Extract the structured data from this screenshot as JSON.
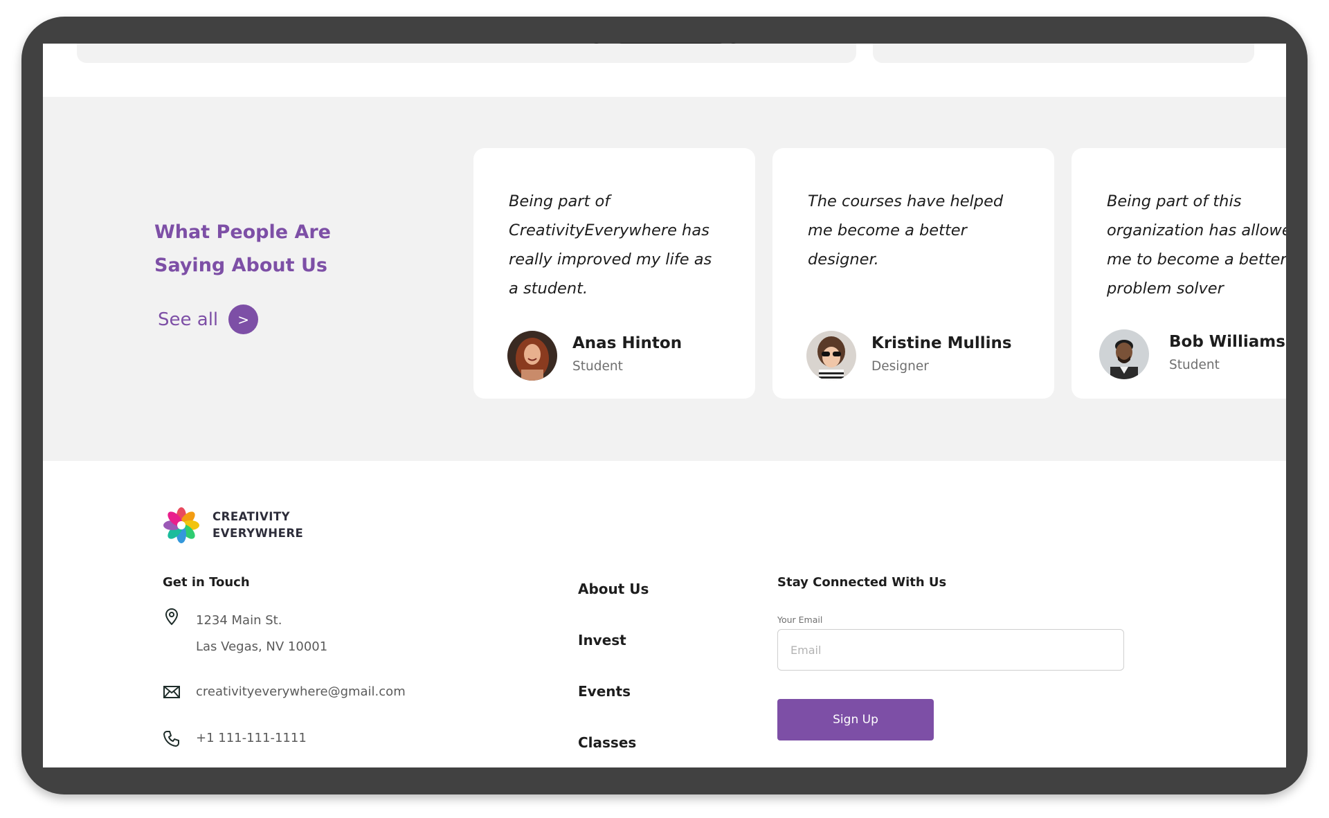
{
  "testimonials": {
    "title": "What People Are Saying About Us",
    "see_all_label": "See all",
    "see_all_arrow": ">",
    "cards": [
      {
        "quote": "Being part of CreativityEverywhere has really improved my life as a student.",
        "name": "Anas Hinton",
        "role": "Student",
        "avatar_icon": "avatar-photo"
      },
      {
        "quote": "The courses have helped me become a better designer.",
        "name": "Kristine Mullins",
        "role": "Designer",
        "avatar_icon": "avatar-photo"
      },
      {
        "quote": "Being part of this organization has allowed me to become a better problem solver",
        "name": "Bob Williams",
        "role": "Student",
        "avatar_icon": "avatar-photo"
      }
    ]
  },
  "footer": {
    "logo": {
      "line1": "CREATIVITY",
      "line2": "EVERYWHERE",
      "icon": "flower-logo"
    },
    "contact": {
      "heading": "Get in Touch",
      "address_line1": "1234 Main St.",
      "address_line2": "Las Vegas, NV 10001",
      "email": "creativityeverywhere@gmail.com",
      "phone": "+1 111-111-1111"
    },
    "nav": [
      {
        "label": "About Us"
      },
      {
        "label": "Invest"
      },
      {
        "label": "Events"
      },
      {
        "label": "Classes"
      }
    ],
    "newsletter": {
      "heading": "Stay Connected With Us",
      "email_label": "Your Email",
      "email_placeholder": "Email",
      "button_label": "Sign Up"
    }
  },
  "colors": {
    "accent": "#7d4fa6",
    "section_bg": "#f2f2f2",
    "device_frame": "#414141"
  }
}
